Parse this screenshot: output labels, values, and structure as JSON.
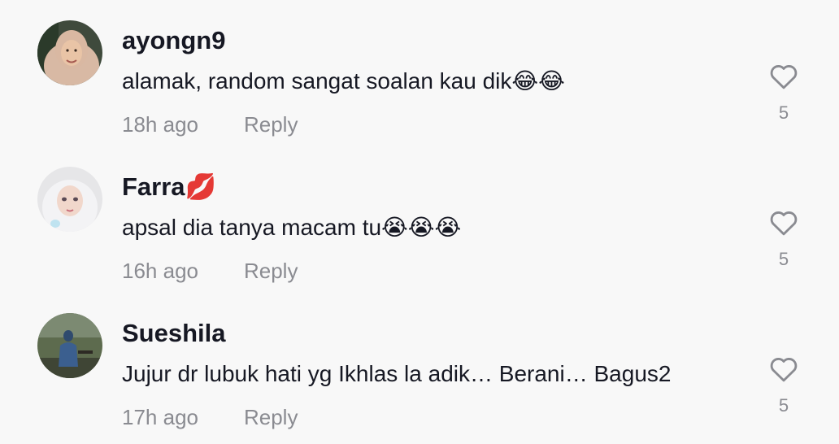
{
  "comments": [
    {
      "username": "ayongn9",
      "text": "alamak, random sangat soalan kau dik😂😂",
      "time": "18h ago",
      "reply_label": "Reply",
      "likes": "5",
      "avatar": "woman-in-hijab-avatar"
    },
    {
      "username": "Farra💋",
      "text": "apsal dia tanya macam tu😭😭😭",
      "time": "16h ago",
      "reply_label": "Reply",
      "likes": "5",
      "avatar": "illustrated-woman-in-hijab-avatar"
    },
    {
      "username": "Sueshila",
      "text": "Jujur dr lubuk hati yg Ikhlas la adik… Berani… Bagus2",
      "time": "17h ago",
      "reply_label": "Reply",
      "likes": "5",
      "avatar": "person-sitting-outdoors-avatar"
    }
  ],
  "icons": {
    "like": "heart-outline-icon"
  },
  "colors": {
    "text": "#161823",
    "muted": "#8a8b91",
    "background": "#f8f8f8"
  }
}
